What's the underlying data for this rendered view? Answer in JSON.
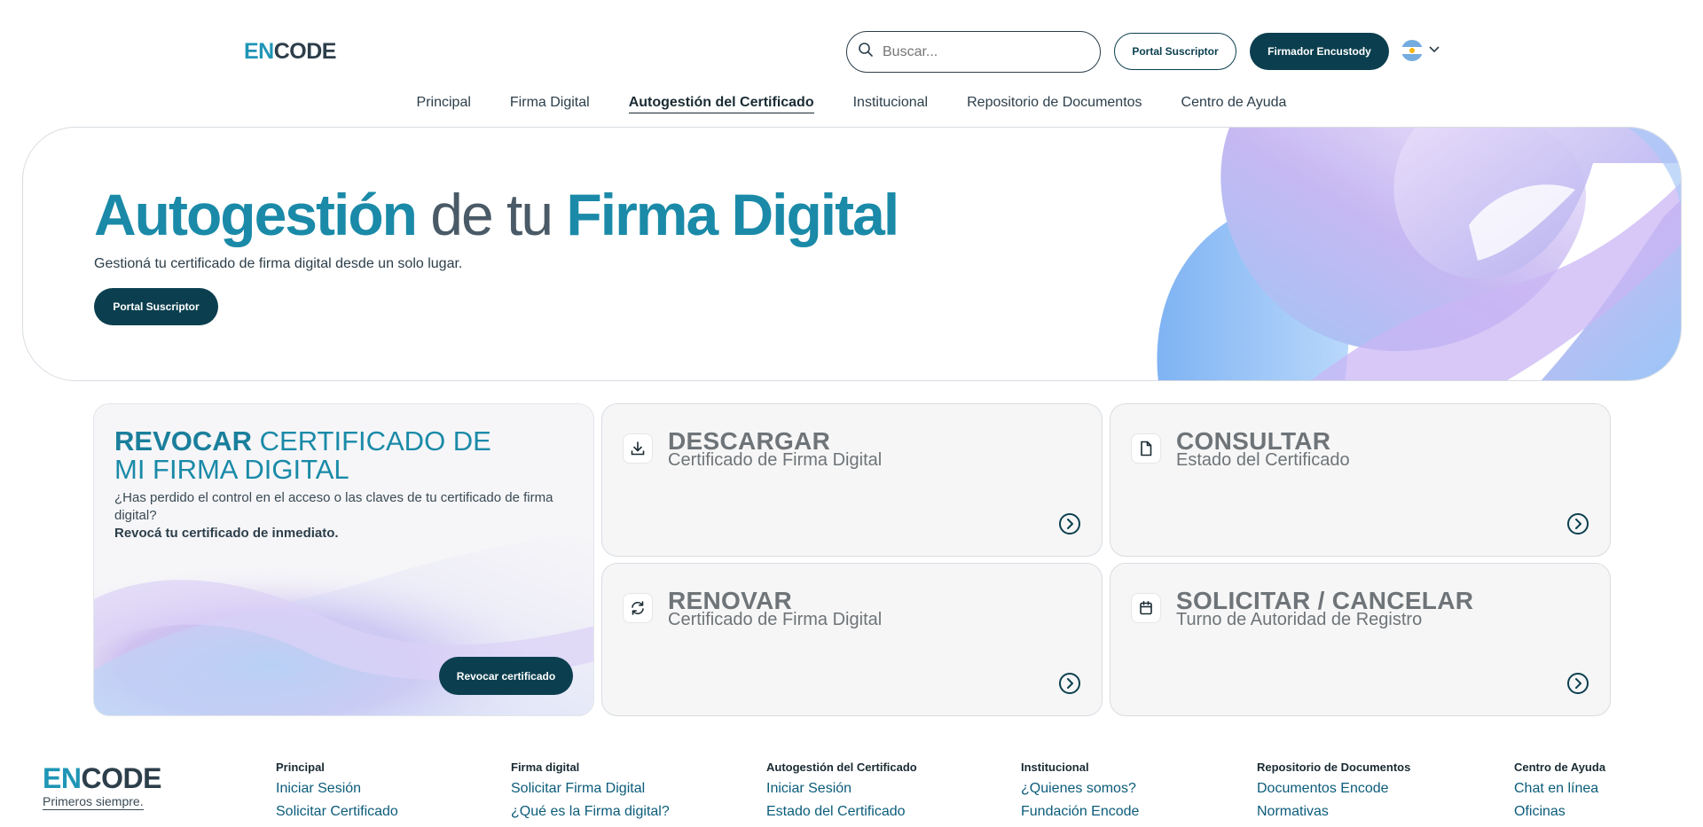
{
  "header": {
    "logo_en": "EN",
    "logo_code": "CODE",
    "search_placeholder": "Buscar...",
    "portal_button": "Portal Suscriptor",
    "firmador_button": "Firmador Encustody"
  },
  "nav": {
    "items": [
      {
        "label": "Principal"
      },
      {
        "label": "Firma Digital"
      },
      {
        "label": "Autogestión del Certificado",
        "active": true
      },
      {
        "label": "Institucional"
      },
      {
        "label": "Repositorio de Documentos"
      },
      {
        "label": "Centro de Ayuda"
      }
    ]
  },
  "hero": {
    "title_part1": "Autogestión",
    "title_part2": " de tu ",
    "title_part3": "Firma Digital",
    "subtitle": "Gestioná tu certificado de firma digital desde un solo lugar.",
    "button": "Portal Suscriptor"
  },
  "revoke": {
    "title_bold": "REVOCAR",
    "title_rest": " CERTIFICADO DE MI FIRMA DIGITAL",
    "description": "¿Has perdido el control en el acceso o las claves de tu certificado de firma digital?",
    "strong": "Revocá tu certificado de inmediato.",
    "button": "Revocar certificado"
  },
  "cards": [
    {
      "title": "DESCARGAR",
      "subtitle": "Certificado de Firma Digital",
      "icon": "download-icon"
    },
    {
      "title": "CONSULTAR",
      "subtitle": "Estado del Certificado",
      "icon": "document-icon"
    },
    {
      "title": "RENOVAR",
      "subtitle": "Certificado de Firma Digital",
      "icon": "refresh-icon"
    },
    {
      "title": "SOLICITAR / CANCELAR",
      "subtitle": "Turno de Autoridad de Registro",
      "icon": "calendar-icon"
    }
  ],
  "footer": {
    "logo_en": "EN",
    "logo_code": "CODE",
    "tagline": "Primeros siempre.",
    "columns": [
      {
        "heading": "Principal",
        "links": [
          "Iniciar Sesión",
          "Solicitar Certificado"
        ]
      },
      {
        "heading": "Firma digital",
        "links": [
          "Solicitar Firma Digital",
          "¿Qué es la Firma digital?"
        ]
      },
      {
        "heading": "Autogestión del Certificado",
        "links": [
          "Iniciar Sesión",
          "Estado del Certificado"
        ]
      },
      {
        "heading": "Institucional",
        "links": [
          "¿Quienes somos?",
          "Fundación Encode"
        ]
      },
      {
        "heading": "Repositorio de Documentos",
        "links": [
          "Documentos Encode",
          "Normativas"
        ]
      },
      {
        "heading": "Centro de Ayuda",
        "links": [
          "Chat en línea",
          "Oficinas"
        ]
      }
    ]
  },
  "colors": {
    "brand_dark": "#0b3f4f",
    "brand_teal": "#1a8aa8"
  }
}
